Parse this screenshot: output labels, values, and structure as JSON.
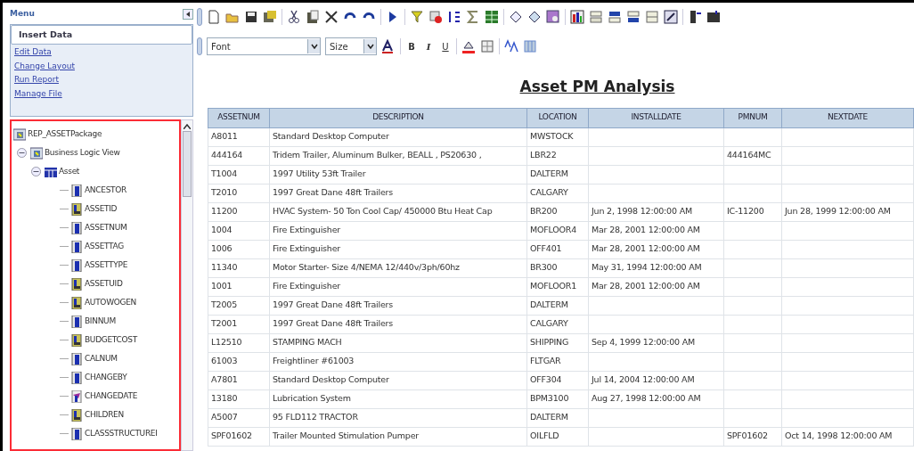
{
  "menu": {
    "title": "Menu",
    "items": [
      {
        "label": "Insert Data",
        "selected": true
      },
      {
        "label": "Edit Data",
        "selected": false
      },
      {
        "label": "Change Layout",
        "selected": false
      },
      {
        "label": "Run Report",
        "selected": false
      },
      {
        "label": "Manage File",
        "selected": false
      }
    ]
  },
  "tree": {
    "label": "REP_ASSETPackage",
    "kind": "package",
    "children": [
      {
        "label": "Business Logic View",
        "kind": "view",
        "expanded": true,
        "children": [
          {
            "label": "Asset",
            "kind": "table",
            "expanded": true,
            "children": [
              {
                "label": "ANCESTOR",
                "kind": "string"
              },
              {
                "label": "ASSETID",
                "kind": "number"
              },
              {
                "label": "ASSETNUM",
                "kind": "string"
              },
              {
                "label": "ASSETTAG",
                "kind": "string"
              },
              {
                "label": "ASSETTYPE",
                "kind": "string"
              },
              {
                "label": "ASSETUID",
                "kind": "number"
              },
              {
                "label": "AUTOWOGEN",
                "kind": "number"
              },
              {
                "label": "BINNUM",
                "kind": "string"
              },
              {
                "label": "BUDGETCOST",
                "kind": "number"
              },
              {
                "label": "CALNUM",
                "kind": "string"
              },
              {
                "label": "CHANGEBY",
                "kind": "string"
              },
              {
                "label": "CHANGEDATE",
                "kind": "date"
              },
              {
                "label": "CHILDREN",
                "kind": "number"
              },
              {
                "label": "CLASSSTRUCTUREI",
                "kind": "string"
              }
            ]
          }
        ]
      }
    ]
  },
  "format_toolbar": {
    "font": "Font",
    "size": "Size",
    "bold": "B",
    "italic": "I",
    "underline": "U"
  },
  "report": {
    "title": "Asset PM Analysis",
    "columns": [
      "ASSETNUM",
      "DESCRIPTION",
      "LOCATION",
      "INSTALLDATE",
      "PMNUM",
      "NEXTDATE"
    ],
    "rows": [
      [
        "A8011",
        "Standard Desktop Computer",
        "MWSTOCK",
        "",
        "",
        ""
      ],
      [
        "444164",
        "Tridem Trailer, Aluminum Bulker, BEALL , PS20630 ,",
        "LBR22",
        "",
        "444164MC",
        ""
      ],
      [
        "T1004",
        "1997 Utility 53ft Trailer",
        "DALTERM",
        "",
        "",
        ""
      ],
      [
        "T2010",
        "1997 Great Dane 48ft Trailers",
        "CALGARY",
        "",
        "",
        ""
      ],
      [
        "11200",
        "HVAC System- 50 Ton Cool Cap/ 450000 Btu Heat Cap",
        "BR200",
        "Jun 2, 1998 12:00:00 AM",
        "IC-11200",
        "Jun 28, 1999 12:00:00 AM"
      ],
      [
        "1004",
        "Fire Extinguisher",
        "MOFLOOR4",
        "Mar 28, 2001 12:00:00 AM",
        "",
        ""
      ],
      [
        "1006",
        "Fire Extinguisher",
        "OFF401",
        "Mar 28, 2001 12:00:00 AM",
        "",
        ""
      ],
      [
        "11340",
        "Motor Starter- Size 4/NEMA 12/440v/3ph/60hz",
        "BR300",
        "May 31, 1994 12:00:00 AM",
        "",
        ""
      ],
      [
        "1001",
        "Fire Extinguisher",
        "MOFLOOR1",
        "Mar 28, 2001 12:00:00 AM",
        "",
        ""
      ],
      [
        "T2005",
        "1997 Great Dane 48ft Trailers",
        "DALTERM",
        "",
        "",
        ""
      ],
      [
        "T2001",
        "1997 Great Dane 48ft Trailers",
        "CALGARY",
        "",
        "",
        ""
      ],
      [
        "L12510",
        "STAMPING MACH",
        "SHIPPING",
        "Sep 4, 1999 12:00:00 AM",
        "",
        ""
      ],
      [
        "61003",
        "Freightliner #61003",
        "FLTGAR",
        "",
        "",
        ""
      ],
      [
        "A7801",
        "Standard Desktop Computer",
        "OFF304",
        "Jul 14, 2004 12:00:00 AM",
        "",
        ""
      ],
      [
        "13180",
        "Lubrication System",
        "BPM3100",
        "Aug 27, 1998 12:00:00 AM",
        "",
        ""
      ],
      [
        "A5007",
        "95 FLD112 TRACTOR",
        "DALTERM",
        "",
        "",
        ""
      ],
      [
        "SPF01602",
        "Trailer Mounted Stimulation Pumper",
        "OILFLD",
        "",
        "SPF01602",
        "Oct 14, 1998 12:00:00 AM"
      ]
    ]
  }
}
